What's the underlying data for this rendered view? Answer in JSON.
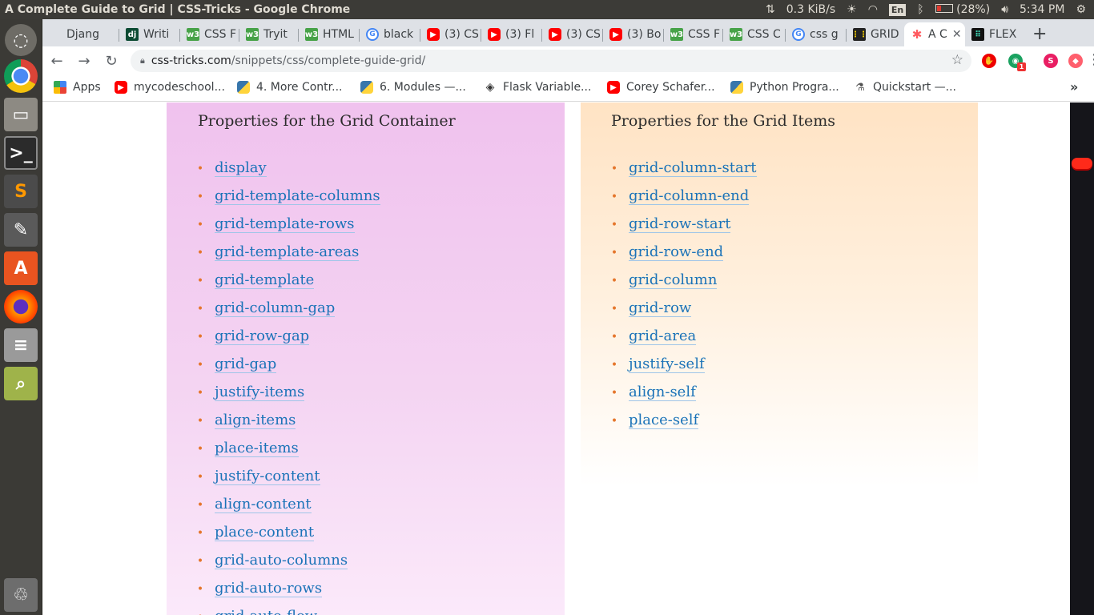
{
  "window": {
    "title": "A Complete Guide to Grid | CSS-Tricks - Google Chrome"
  },
  "systray": {
    "net_speed": "0.3 KiB/s",
    "keyboard": "En",
    "battery": "(28%)",
    "clock": "5:34 PM"
  },
  "tabs": [
    {
      "label": "Djang",
      "icon": "django-tab-icon"
    },
    {
      "label": "Writi",
      "icon": "django-dj-icon",
      "fav": "dj"
    },
    {
      "label": "CSS F",
      "icon": "w3schools-icon",
      "fav": "w3"
    },
    {
      "label": "Tryit",
      "icon": "w3schools-icon",
      "fav": "w3"
    },
    {
      "label": "HTML",
      "icon": "w3schools-icon",
      "fav": "w3"
    },
    {
      "label": "black",
      "icon": "google-icon",
      "fav": "G"
    },
    {
      "label": "(3) CS",
      "icon": "youtube-icon",
      "fav": "▶"
    },
    {
      "label": "(3) Fl",
      "icon": "youtube-icon",
      "fav": "▶"
    },
    {
      "label": "(3) CS",
      "icon": "youtube-icon",
      "fav": "▶"
    },
    {
      "label": "(3) Bo",
      "icon": "youtube-icon",
      "fav": "▶"
    },
    {
      "label": "CSS F",
      "icon": "w3schools-icon",
      "fav": "w3"
    },
    {
      "label": "CSS C",
      "icon": "w3schools-icon",
      "fav": "w3"
    },
    {
      "label": "css g",
      "icon": "google-icon",
      "fav": "G"
    },
    {
      "label": "GRID",
      "icon": "grid-icon",
      "fav": "⋮⋮"
    },
    {
      "label": "A C",
      "icon": "css-tricks-icon",
      "fav": "✱"
    },
    {
      "label": "FLEX",
      "icon": "flex-icon",
      "fav": "⠿"
    }
  ],
  "address": {
    "domain": "css-tricks.com",
    "path": "/snippets/css/complete-guide-grid/"
  },
  "bookmarks": [
    {
      "label": "Apps"
    },
    {
      "label": "mycodeschool..."
    },
    {
      "label": "4. More Contr..."
    },
    {
      "label": "6. Modules —..."
    },
    {
      "label": "Flask Variable..."
    },
    {
      "label": "Corey Schafer..."
    },
    {
      "label": "Python Progra..."
    },
    {
      "label": "Quickstart —..."
    }
  ],
  "extensions": {
    "green_badge": "1",
    "profile_initial": "S"
  },
  "panels": {
    "container": {
      "heading": "Properties for the Grid Container",
      "items": [
        "display",
        "grid-template-columns",
        "grid-template-rows",
        "grid-template-areas",
        "grid-template",
        "grid-column-gap",
        "grid-row-gap",
        "grid-gap",
        "justify-items",
        "align-items",
        "place-items",
        "justify-content",
        "align-content",
        "place-content",
        "grid-auto-columns",
        "grid-auto-rows",
        "grid-auto-flow"
      ]
    },
    "items": {
      "heading": "Properties for the Grid Items",
      "items": [
        "grid-column-start",
        "grid-column-end",
        "grid-row-start",
        "grid-row-end",
        "grid-column",
        "grid-row",
        "grid-area",
        "justify-self",
        "align-self",
        "place-self"
      ]
    }
  },
  "colors": {
    "container_panel": "#f0c2ee",
    "items_panel": "#ffe3c4",
    "link": "#1b73b8",
    "bullet": "#e5762c"
  }
}
